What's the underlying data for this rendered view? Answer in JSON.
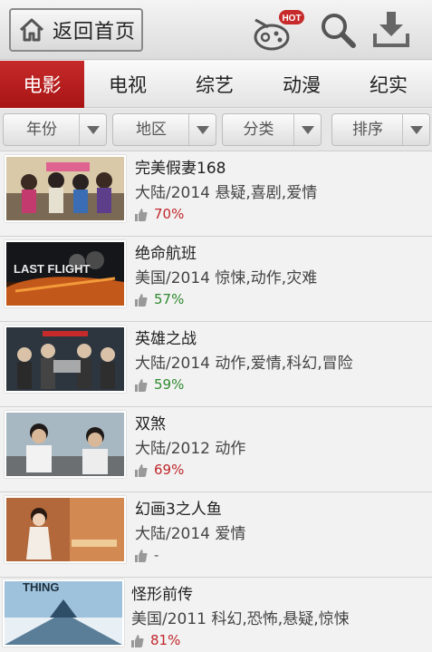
{
  "header": {
    "back_label": "返回首页",
    "hot_badge": "HOT"
  },
  "tabs": [
    {
      "label": "电影",
      "active": true
    },
    {
      "label": "电视",
      "active": false
    },
    {
      "label": "综艺",
      "active": false
    },
    {
      "label": "动漫",
      "active": false
    },
    {
      "label": "纪实",
      "active": false
    }
  ],
  "filters": [
    {
      "label": "年份"
    },
    {
      "label": "地区"
    },
    {
      "label": "分类"
    },
    {
      "label": "排序"
    }
  ],
  "colors": {
    "accent_red": "#b51c1c",
    "rating_red": "#c0262b",
    "rating_green": "#2f8a2f"
  },
  "movies": [
    {
      "title": "完美假妻168",
      "meta": "大陆/2014  悬疑,喜剧,爱情",
      "rating": "70%",
      "rating_color": "red",
      "poster_text": ""
    },
    {
      "title": "绝命航班",
      "meta": "美国/2014  惊悚,动作,灾难",
      "rating": "57%",
      "rating_color": "green",
      "poster_text": "LAST FLIGHT"
    },
    {
      "title": "英雄之战",
      "meta": "大陆/2014  动作,爱情,科幻,冒险",
      "rating": "59%",
      "rating_color": "green",
      "poster_text": ""
    },
    {
      "title": "双煞",
      "meta": "大陆/2012  动作",
      "rating": "69%",
      "rating_color": "red",
      "poster_text": ""
    },
    {
      "title": "幻画3之人鱼",
      "meta": "大陆/2014  爱情",
      "rating": "-",
      "rating_color": "none",
      "poster_text": ""
    },
    {
      "title": "怪形前传",
      "meta": "美国/2011  科幻,恐怖,悬疑,惊悚",
      "rating": "81%",
      "rating_color": "red",
      "poster_text": "THING"
    }
  ]
}
